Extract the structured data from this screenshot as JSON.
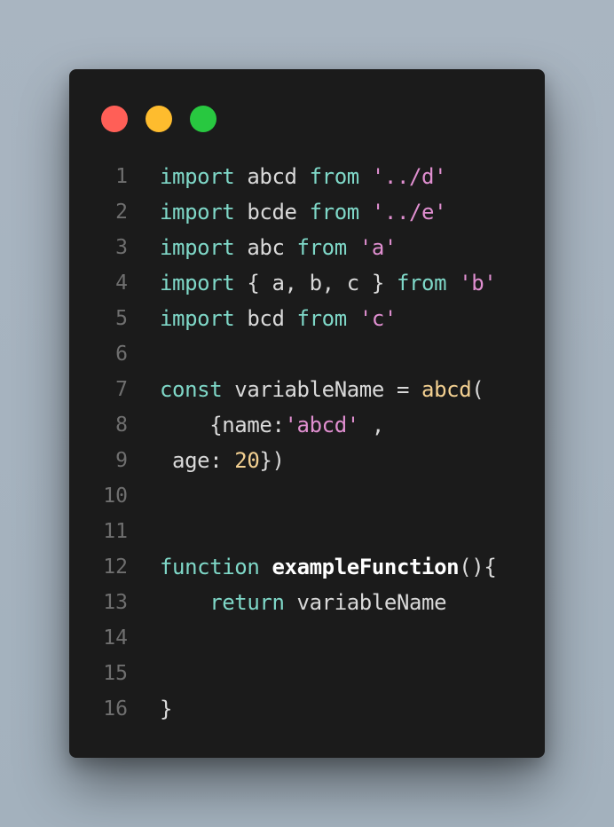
{
  "window": {
    "controls": [
      {
        "name": "close",
        "color": "#ff5f57"
      },
      {
        "name": "minimize",
        "color": "#febc2e"
      },
      {
        "name": "maximize",
        "color": "#28c840"
      }
    ]
  },
  "colors": {
    "keyword": "#7fd8c8",
    "string": "#e08fd0",
    "number": "#f3d091",
    "function_call": "#f3d091",
    "function_def": "#ffffff",
    "plain": "#d9d9d9",
    "line_number": "#6f6f6f",
    "editor_background": "#1b1b1b"
  },
  "code": {
    "lines": [
      {
        "number": "1",
        "tokens": [
          {
            "type": "keyword",
            "text": "import"
          },
          {
            "type": "plain",
            "text": " abcd "
          },
          {
            "type": "keyword",
            "text": "from"
          },
          {
            "type": "plain",
            "text": " "
          },
          {
            "type": "string",
            "text": "'../d'"
          }
        ]
      },
      {
        "number": "2",
        "tokens": [
          {
            "type": "keyword",
            "text": "import"
          },
          {
            "type": "plain",
            "text": " bcde "
          },
          {
            "type": "keyword",
            "text": "from"
          },
          {
            "type": "plain",
            "text": " "
          },
          {
            "type": "string",
            "text": "'../e'"
          }
        ]
      },
      {
        "number": "3",
        "tokens": [
          {
            "type": "keyword",
            "text": "import"
          },
          {
            "type": "plain",
            "text": " abc "
          },
          {
            "type": "keyword",
            "text": "from"
          },
          {
            "type": "plain",
            "text": " "
          },
          {
            "type": "string",
            "text": "'a'"
          }
        ]
      },
      {
        "number": "4",
        "tokens": [
          {
            "type": "keyword",
            "text": "import"
          },
          {
            "type": "plain",
            "text": " { a, b, c } "
          },
          {
            "type": "keyword",
            "text": "from"
          },
          {
            "type": "plain",
            "text": " "
          },
          {
            "type": "string",
            "text": "'b'"
          }
        ]
      },
      {
        "number": "5",
        "tokens": [
          {
            "type": "keyword",
            "text": "import"
          },
          {
            "type": "plain",
            "text": " bcd "
          },
          {
            "type": "keyword",
            "text": "from"
          },
          {
            "type": "plain",
            "text": " "
          },
          {
            "type": "string",
            "text": "'c'"
          }
        ]
      },
      {
        "number": "6",
        "tokens": []
      },
      {
        "number": "7",
        "tokens": [
          {
            "type": "keyword",
            "text": "const"
          },
          {
            "type": "plain",
            "text": " variableName = "
          },
          {
            "type": "func",
            "text": "abcd"
          },
          {
            "type": "plain",
            "text": "("
          }
        ]
      },
      {
        "number": "8",
        "tokens": [
          {
            "type": "plain",
            "text": "    {name:"
          },
          {
            "type": "string",
            "text": "'abcd'"
          },
          {
            "type": "plain",
            "text": " ,"
          }
        ]
      },
      {
        "number": "9",
        "tokens": [
          {
            "type": "plain",
            "text": " age: "
          },
          {
            "type": "number",
            "text": "20"
          },
          {
            "type": "plain",
            "text": "})"
          }
        ]
      },
      {
        "number": "10",
        "tokens": []
      },
      {
        "number": "11",
        "tokens": []
      },
      {
        "number": "12",
        "tokens": [
          {
            "type": "keyword",
            "text": "function"
          },
          {
            "type": "plain",
            "text": " "
          },
          {
            "type": "def",
            "text": "exampleFunction"
          },
          {
            "type": "plain",
            "text": "(){"
          }
        ]
      },
      {
        "number": "13",
        "tokens": [
          {
            "type": "plain",
            "text": "    "
          },
          {
            "type": "keyword",
            "text": "return"
          },
          {
            "type": "plain",
            "text": " variableName"
          }
        ]
      },
      {
        "number": "14",
        "tokens": []
      },
      {
        "number": "15",
        "tokens": []
      },
      {
        "number": "16",
        "tokens": [
          {
            "type": "plain",
            "text": "}"
          }
        ]
      }
    ]
  }
}
